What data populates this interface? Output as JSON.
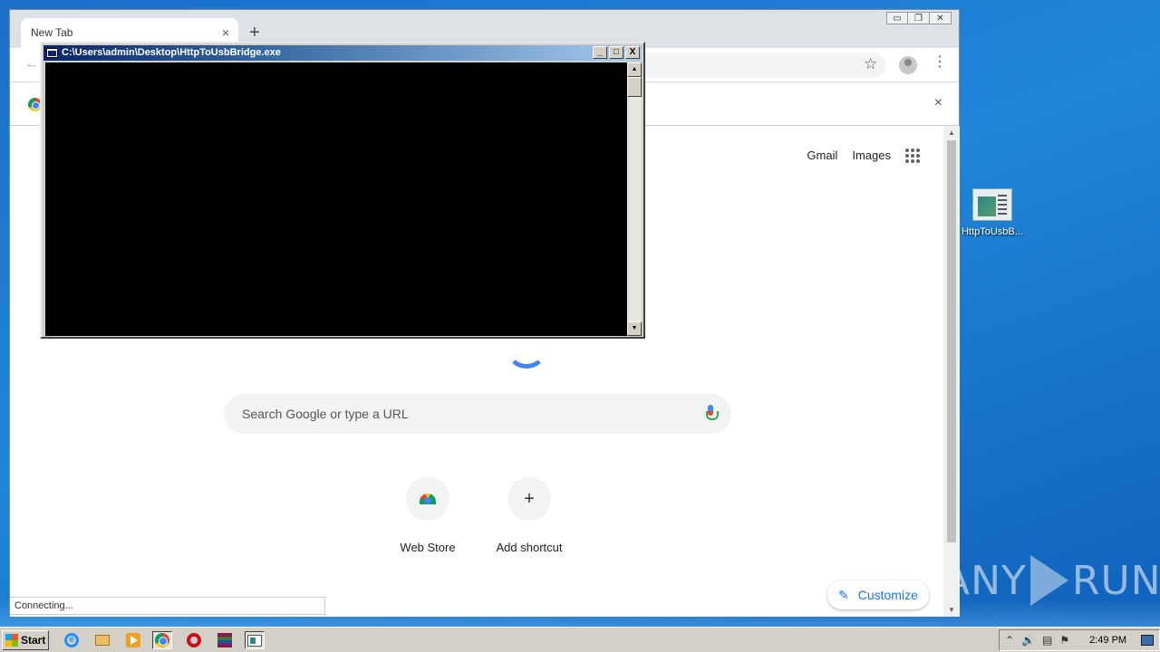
{
  "browser": {
    "tab_title": "New Tab",
    "tab_close": "×",
    "new_tab": "+",
    "back": "←",
    "star": "☆",
    "menu": "⋮",
    "infobar_close": "×",
    "window_buttons": [
      "▭",
      "❐",
      "✕"
    ],
    "status_text": "Connecting..."
  },
  "newtab": {
    "top_links": [
      "Gmail",
      "Images"
    ],
    "search_placeholder": "Search Google or type a URL",
    "shortcuts": [
      {
        "label": "Web Store",
        "icon": "webstore-icon"
      },
      {
        "label": "Add shortcut",
        "icon": "plus-icon",
        "glyph": "+"
      }
    ],
    "customize_label": "Customize",
    "customize_glyph": "✎"
  },
  "console": {
    "title": "C:\\Users\\admin\\Desktop\\HttpToUsbBridge.exe",
    "buttons": [
      "_",
      "□",
      "X"
    ],
    "scroll_up": "▲",
    "scroll_down": "▼"
  },
  "desktop": {
    "icon_label": "HttpToUsbB...",
    "watermark": [
      "ANY",
      "RUN"
    ]
  },
  "taskbar": {
    "start_label": "Start",
    "tray_icons": [
      "⌃",
      "🔊",
      "▤",
      "⚑"
    ],
    "clock": "2:49 PM"
  },
  "colors": {
    "desktop_blue": "#1f86d9",
    "chrome_frame": "#dee1e6",
    "google_blue": "#1a73e8",
    "console_title_start": "#0a246a"
  }
}
